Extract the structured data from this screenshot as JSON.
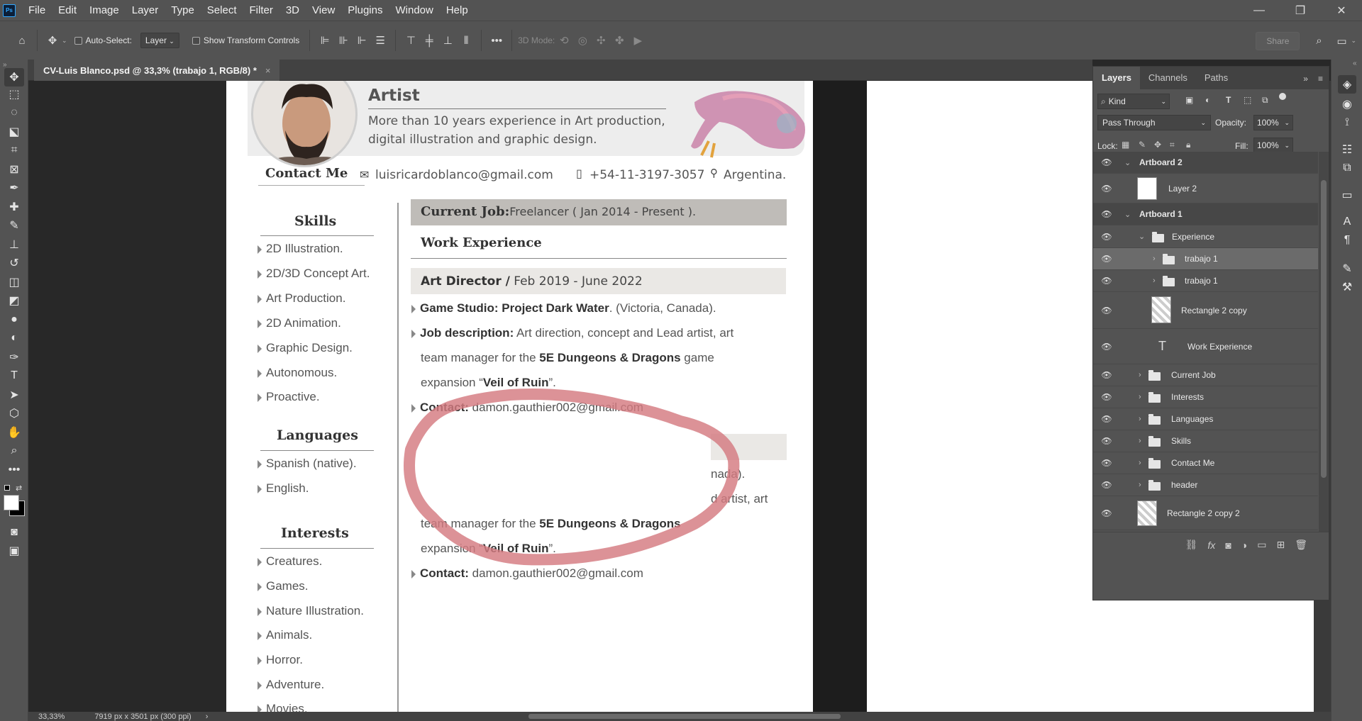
{
  "app": {
    "logo": "Ps",
    "menu": [
      "File",
      "Edit",
      "Image",
      "Layer",
      "Type",
      "Select",
      "Filter",
      "3D",
      "View",
      "Plugins",
      "Window",
      "Help"
    ]
  },
  "options": {
    "auto_select_label": "Auto-Select:",
    "auto_select_value": "Layer",
    "transform_label": "Show Transform Controls",
    "mode3d_label": "3D Mode:",
    "share_label": "Share"
  },
  "document_tab": {
    "title": "CV-Luis Blanco.psd @ 33,3% (trabajo 1, RGB/8) *",
    "close": "×"
  },
  "status": {
    "zoom": "33,33%",
    "doc_info": "7919 px x 3501 px (300 ppi)"
  },
  "cv": {
    "role": "Artist",
    "summary_line1": "More than 10 years experience in Art production,",
    "summary_line2": "digital illustration and graphic design.",
    "contact_heading": "Contact Me",
    "email": "luisricardoblanco@gmail.com",
    "phone": "+54-11-3197-3057",
    "location": "Argentina.",
    "skills_heading": "Skills",
    "skills": [
      "2D Illustration.",
      "2D/3D Concept Art.",
      "Art Production.",
      "2D Animation.",
      "Graphic Design.",
      "Autonomous.",
      "Proactive."
    ],
    "languages_heading": "Languages",
    "languages": [
      "Spanish (native).",
      "English."
    ],
    "interests_heading": "Interests",
    "interests": [
      "Creatures.",
      "Games.",
      "Nature Illustration.",
      "Animals.",
      "Horror.",
      "Adventure.",
      "Movies."
    ],
    "current_job_label": "Current Job:",
    "current_job_value": "Freelancer ( Jan 2014 - Present ).",
    "work_heading": "Work Experience",
    "job_title": "Art Director /",
    "job_dates": "Feb 2019 - June 2022",
    "studio_label": "Game Studio:",
    "studio_name": "Project Dark Water",
    "studio_location": ". (Victoria, Canada).",
    "desc_label": "Job description:",
    "desc_text1": " Art direction, concept and Lead artist, art",
    "desc_text2": "team manager for the ",
    "desc_bold": "5E Dungeons & Dragons",
    "desc_text3": " game",
    "desc_text4": "expansion “",
    "desc_bold2": "Veil of Ruin",
    "desc_text5": "”.",
    "contact_label": "Contact:",
    "contact_email": " damon.gauthier002@gmail.com",
    "dup_frag1": "nada).",
    "dup_frag2": "d artist, art",
    "dup_line3a": "team manager for the ",
    "dup_line3b": "5E Dungeons & Dragons",
    "dup_line4a": "expansion “",
    "dup_line4b": "Veil of Ruin",
    "dup_line4c": "”.",
    "dup_contact_label": "Contact:",
    "dup_contact_email": " damon.gauthier002@gmail.com"
  },
  "layers_panel": {
    "tabs": [
      "Layers",
      "Channels",
      "Paths"
    ],
    "filter_kind": "Kind",
    "blend_mode": "Pass Through",
    "opacity_label": "Opacity:",
    "opacity_value": "100%",
    "lock_label": "Lock:",
    "fill_label": "Fill:",
    "fill_value": "100%",
    "rows": [
      {
        "name": "Artboard 2"
      },
      {
        "name": "Layer 2"
      },
      {
        "name": "Artboard 1"
      },
      {
        "name": "Experience"
      },
      {
        "name": "trabajo 1"
      },
      {
        "name": "trabajo 1"
      },
      {
        "name": "Rectangle 2 copy"
      },
      {
        "name": "Work Experience"
      },
      {
        "name": "Current Job"
      },
      {
        "name": "Interests"
      },
      {
        "name": "Languages"
      },
      {
        "name": "Skills"
      },
      {
        "name": "Contact Me"
      },
      {
        "name": "header"
      },
      {
        "name": "Rectangle 2 copy 2"
      }
    ]
  },
  "colors": {
    "annotation": "#d47a80",
    "highlight_row": "#6b6b6b",
    "accent": "#31a8ff"
  }
}
